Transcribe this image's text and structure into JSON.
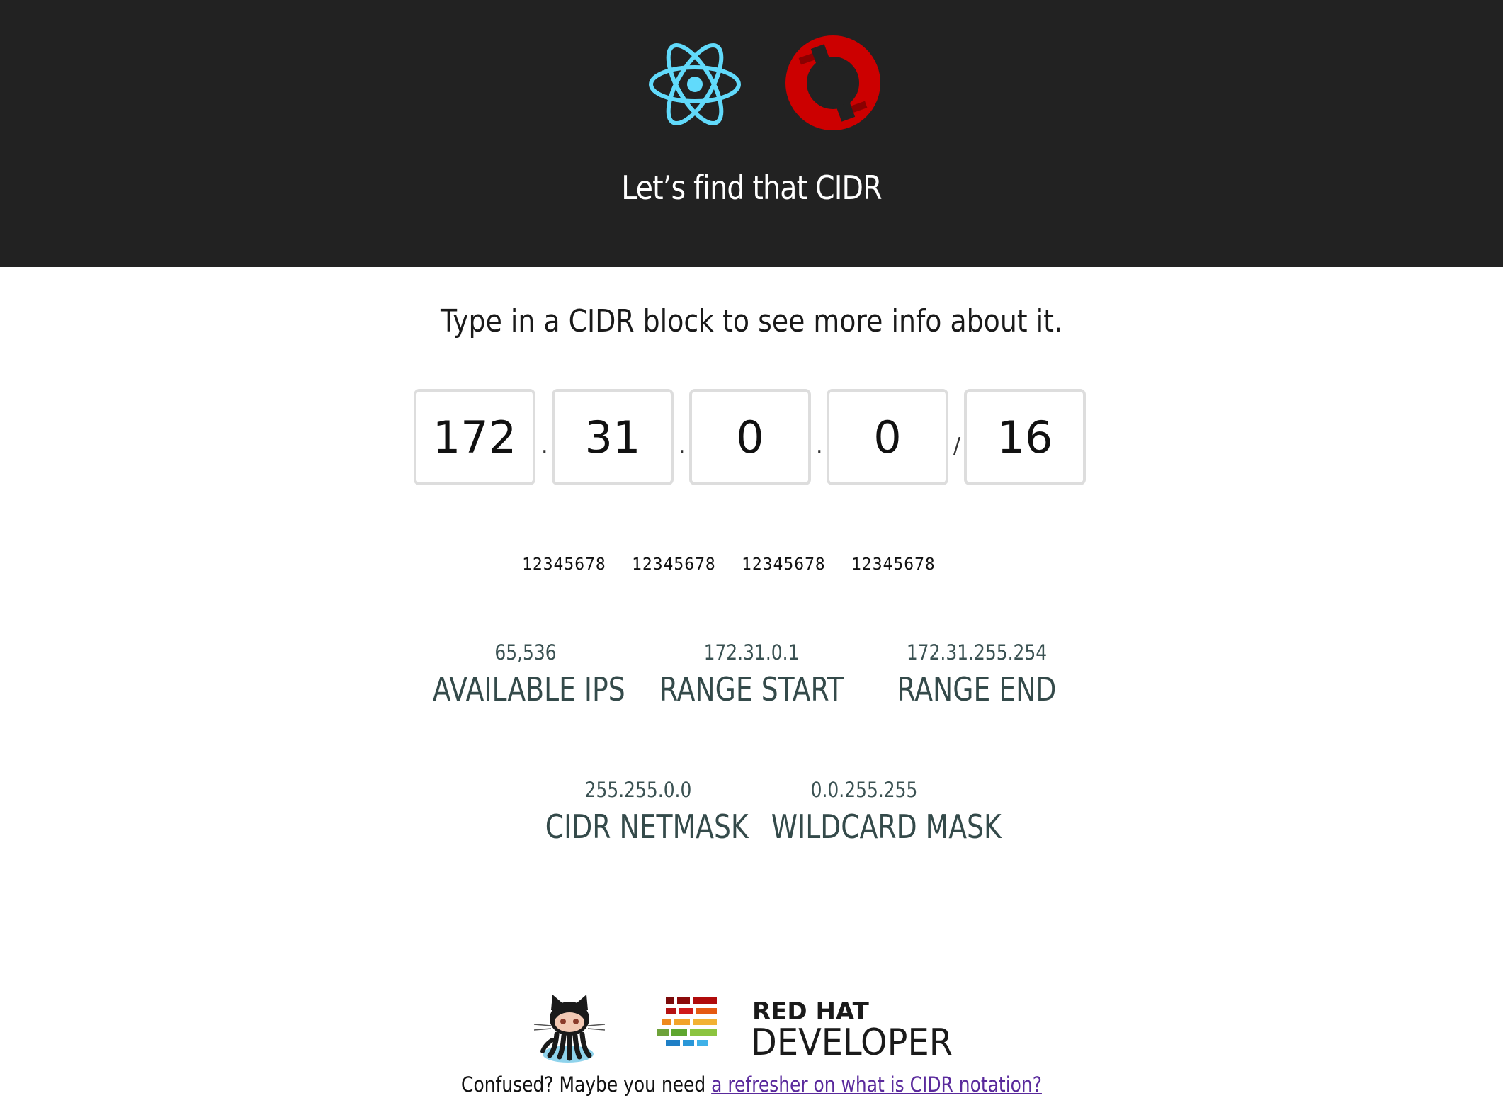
{
  "header": {
    "title": "Let’s find that CIDR",
    "logos": [
      "react-logo",
      "openshift-logo"
    ],
    "background": "#222222"
  },
  "prompt": "Type in a CIDR block to see more info about it.",
  "cidr": {
    "octets": [
      "172",
      "31",
      "0",
      "0"
    ],
    "prefix": "16",
    "separators": [
      ".",
      ".",
      ".",
      "/"
    ]
  },
  "bit_labels": [
    "12345678",
    "12345678",
    "12345678",
    "12345678"
  ],
  "stats": {
    "available_ips": {
      "value": "65,536",
      "label": "AVAILABLE IPS"
    },
    "range_start": {
      "value": "172.31.0.1",
      "label": "RANGE START"
    },
    "range_end": {
      "value": "172.31.255.254",
      "label": "RANGE END"
    },
    "cidr_netmask": {
      "value": "255.255.0.0",
      "label": "CIDR NETMASK"
    },
    "wildcard_mask": {
      "value": "0.0.255.255",
      "label": "WILDCARD MASK"
    }
  },
  "footer": {
    "logos": [
      "github-octocat-logo",
      "red-hat-developer-logo"
    ],
    "redhat_brand": "RED HAT",
    "redhat_product": "DEVELOPER",
    "text": "Confused? Maybe you need",
    "link_text": "a refresher on what is CIDR notation?"
  },
  "colors": {
    "react": "#61dafb",
    "openshift": "#cc0000",
    "stat_text": "#344a4a",
    "link": "#5a2a9c"
  }
}
